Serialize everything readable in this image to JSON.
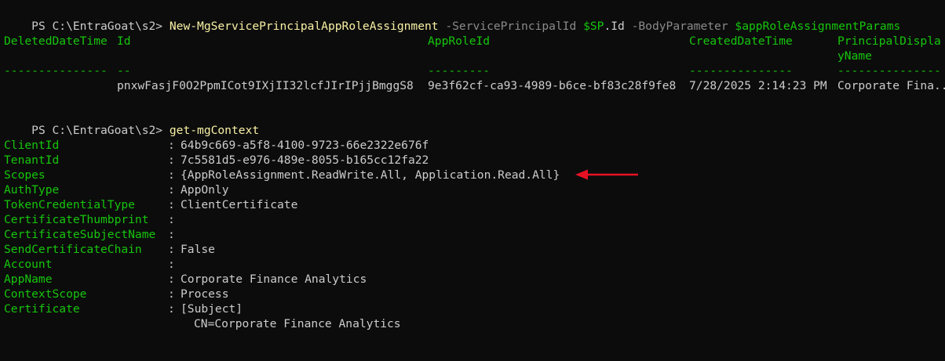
{
  "terminal": {
    "prompt1": "PS C:\\EntraGoat\\s2>",
    "cmd1": {
      "name": "New-MgServicePrincipalAppRoleAssignment",
      "param1": "-ServicePrincipalId",
      "var1": "$SP",
      "prop1": ".Id",
      "param2": "-BodyParameter",
      "var2": "$appRoleAssignmentParams"
    },
    "table": {
      "headers": {
        "deleted": "DeletedDateTime",
        "id": "Id",
        "approle": "AppRoleId",
        "created": "CreatedDateTime",
        "principal1": "PrincipalDispla",
        "principal2": "yName"
      },
      "separators": {
        "deleted": "---------------",
        "id": "--",
        "approle": "---------",
        "created": "---------------",
        "principal": "---------------"
      },
      "row": {
        "id": "pnxwFasjF0O2PpmICot9IXjII32lcfJIrIPjjBmggS8",
        "approle": "9e3f62cf-ca93-4989-b6ce-bf83c28f9fe8",
        "created": "7/28/2025 2:14:23 PM",
        "principal": "Corporate Fina..."
      }
    },
    "prompt2": "PS C:\\EntraGoat\\s2>",
    "cmd2": "get-mgContext",
    "context": [
      {
        "key": "ClientId",
        "value": "64b9c669-a5f8-4100-9723-66e2322e676f"
      },
      {
        "key": "TenantId",
        "value": "7c5581d5-e976-489e-8055-b165cc12fa22"
      },
      {
        "key": "Scopes",
        "value": "{AppRoleAssignment.ReadWrite.All, Application.Read.All}"
      },
      {
        "key": "AuthType",
        "value": "AppOnly"
      },
      {
        "key": "TokenCredentialType",
        "value": "ClientCertificate"
      },
      {
        "key": "CertificateThumbprint",
        "value": ""
      },
      {
        "key": "CertificateSubjectName",
        "value": ""
      },
      {
        "key": "SendCertificateChain",
        "value": "False"
      },
      {
        "key": "Account",
        "value": ""
      },
      {
        "key": "AppName",
        "value": "Corporate Finance Analytics"
      },
      {
        "key": "ContextScope",
        "value": "Process"
      },
      {
        "key": "Certificate",
        "value": "[Subject]"
      }
    ],
    "certificate_subject": "CN=Corporate Finance Analytics",
    "separator_colon": ":"
  },
  "annotation": {
    "icon": "red-arrow-icon",
    "color": "#e81123"
  },
  "colors": {
    "background": "#0c0c0c",
    "text": "#cccccc",
    "command": "#f9f1a5",
    "parameter": "#8a8a8a",
    "header": "#16c60c"
  }
}
